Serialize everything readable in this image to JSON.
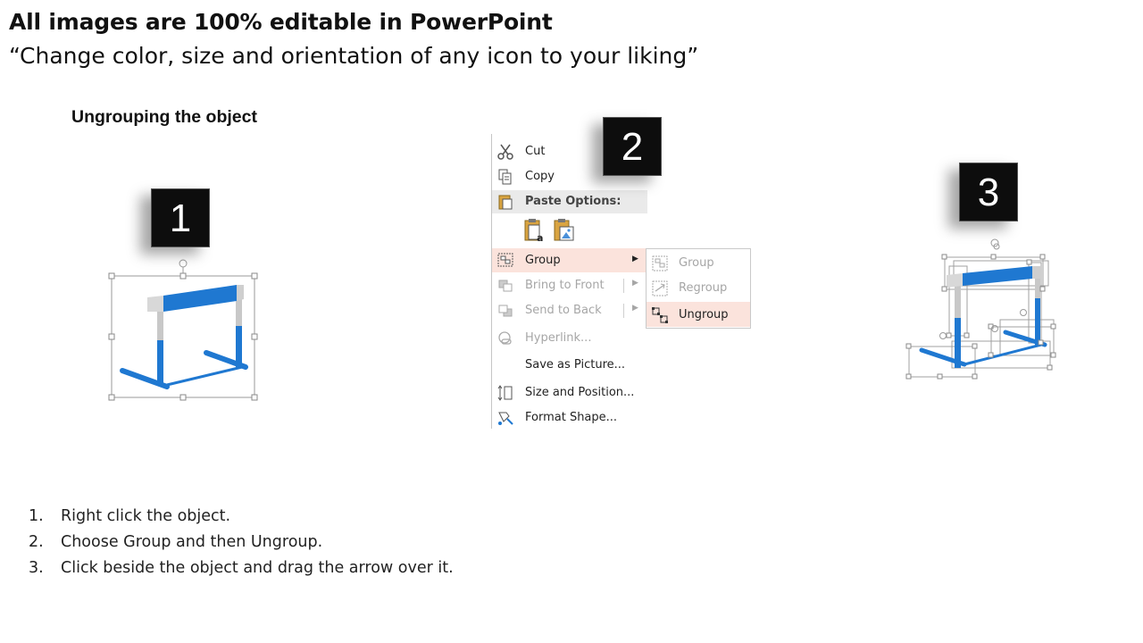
{
  "header": {
    "title": "All images are 100% editable in PowerPoint",
    "subtitle": "“Change color, size and orientation of any icon to your liking”"
  },
  "section_title": "Ungrouping the object",
  "badges": [
    "1",
    "2",
    "3"
  ],
  "context_menu": {
    "items": {
      "cut": "Cut",
      "copy": "Copy",
      "paste_options": "Paste Options:",
      "group": "Group",
      "bring_to_front": "Bring to Front",
      "send_to_back": "Send to Back",
      "hyperlink": "Hyperlink...",
      "save_as_picture": "Save as Picture...",
      "size_and_position": "Size and Position...",
      "format_shape": "Format Shape..."
    },
    "submenu": {
      "group": "Group",
      "regroup": "Regroup",
      "ungroup": "Ungroup"
    }
  },
  "steps": [
    {
      "num": "1.",
      "text": "Right click the object."
    },
    {
      "num": "2.",
      "text": "Choose Group and then Ungroup."
    },
    {
      "num": "3.",
      "text": "Click beside the object and drag the arrow over it."
    }
  ],
  "colors": {
    "hurdle_blue": "#1f78d1",
    "hurdle_gray": "#c8c8c8",
    "highlight": "#fbe3dc",
    "badge_bg": "#0d0d0d"
  },
  "icons": [
    "scissors-icon",
    "copy-icon",
    "paste-icon",
    "group-icon",
    "bring-front-icon",
    "send-back-icon",
    "hyperlink-icon",
    "size-position-icon",
    "format-shape-icon",
    "submenu-arrow-icon",
    "rotate-handle-icon"
  ]
}
